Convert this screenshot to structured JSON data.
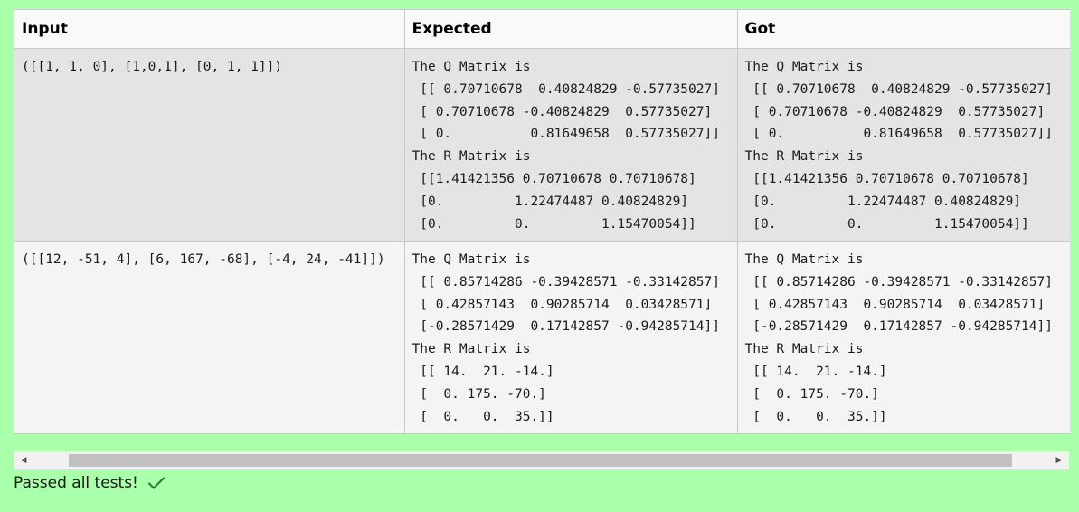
{
  "table": {
    "headers": {
      "input": "Input",
      "expected": "Expected",
      "got": "Got"
    },
    "rows": [
      {
        "input": "([[1, 1, 0], [1,0,1], [0, 1, 1]])",
        "expected": "The Q Matrix is\n [[ 0.70710678  0.40824829 -0.57735027]\n [ 0.70710678 -0.40824829  0.57735027]\n [ 0.          0.81649658  0.57735027]]\nThe R Matrix is\n [[1.41421356 0.70710678 0.70710678]\n [0.         1.22474487 0.40824829]\n [0.         0.         1.15470054]]",
        "got": "The Q Matrix is\n [[ 0.70710678  0.40824829 -0.57735027]\n [ 0.70710678 -0.40824829  0.57735027]\n [ 0.          0.81649658  0.57735027]]\nThe R Matrix is\n [[1.41421356 0.70710678 0.70710678]\n [0.         1.22474487 0.40824829]\n [0.         0.         1.15470054]]"
      },
      {
        "input": "([[12, -51, 4], [6, 167, -68], [-4, 24, -41]])",
        "expected": "The Q Matrix is\n [[ 0.85714286 -0.39428571 -0.33142857]\n [ 0.42857143  0.90285714  0.03428571]\n [-0.28571429  0.17142857 -0.94285714]]\nThe R Matrix is\n [[ 14.  21. -14.]\n [  0. 175. -70.]\n [  0.   0.  35.]]",
        "got": "The Q Matrix is\n [[ 0.85714286 -0.39428571 -0.33142857]\n [ 0.42857143  0.90285714  0.03428571]\n [-0.28571429  0.17142857 -0.94285714]]\nThe R Matrix is\n [[ 14.  21. -14.]\n [  0. 175. -70.]\n [  0.   0.  35.]]"
      }
    ]
  },
  "scrollbar": {
    "left_arrow": "◀",
    "right_arrow": "▶"
  },
  "status": {
    "message": "Passed all tests!",
    "icon": "check-icon"
  },
  "colors": {
    "page_background": "#aaffaa",
    "check_color": "#2e7d32"
  }
}
